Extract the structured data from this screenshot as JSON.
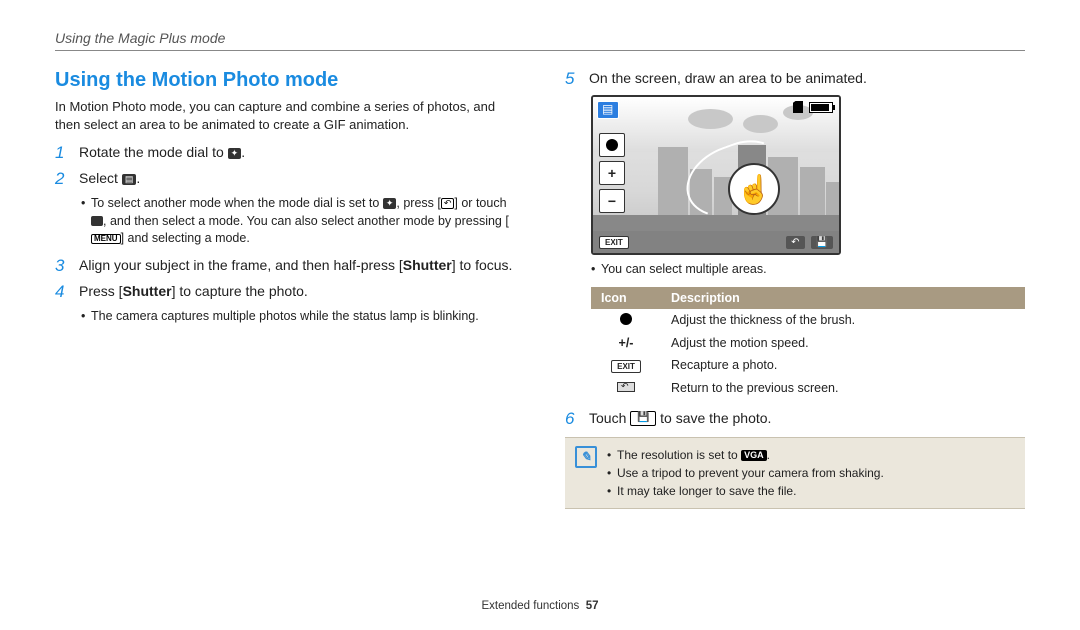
{
  "breadcrumb": "Using the Magic Plus mode",
  "heading": "Using the Motion Photo mode",
  "intro": "In Motion Photo mode, you can capture and combine a series of photos, and then select an area to be animated to create a GIF animation.",
  "steps": {
    "s1_pre": "Rotate the mode dial to ",
    "s1_post": ".",
    "s2_pre": "Select ",
    "s2_post": ".",
    "s2_sub_a_pre": "To select another mode when the mode dial is set to ",
    "s2_sub_a_mid1": ", press [",
    "s2_sub_a_mid2": "] or touch ",
    "s2_sub_a_mid3": ", and then select a mode. You can also select another mode by pressing [",
    "s2_sub_a_post": "] and selecting a mode.",
    "s3_pre": "Align your subject in the frame, and then half-press [",
    "s3_bold": "Shutter",
    "s3_post": "] to focus.",
    "s4_pre": "Press [",
    "s4_bold": "Shutter",
    "s4_post": "] to capture the photo.",
    "s4_sub": "The camera captures multiple photos while the status lamp is blinking.",
    "s5": "On the screen, draw an area to be animated.",
    "s5_sub": "You can select multiple areas.",
    "s6_pre": "Touch ",
    "s6_post": " to save the photo."
  },
  "table": {
    "h_icon": "Icon",
    "h_desc": "Description",
    "rows": [
      {
        "icon": "dot",
        "icon_text": "",
        "desc": "Adjust the thickness of the brush."
      },
      {
        "icon": "pm",
        "icon_text": "+/-",
        "desc": "Adjust the motion speed."
      },
      {
        "icon": "exit",
        "icon_text": "EXIT",
        "desc": "Recapture a photo."
      },
      {
        "icon": "return",
        "icon_text": "",
        "desc": "Return to the previous screen."
      }
    ]
  },
  "notes": {
    "n1_pre": "The resolution is set to ",
    "n1_vga": "VGA",
    "n1_post": ".",
    "n2": "Use a tripod to prevent your camera from shaking.",
    "n3": "It may take longer to save the file."
  },
  "screen": {
    "exit": "EXIT",
    "plus": "+",
    "minus": "−"
  },
  "icons": {
    "menu_label": "MENU"
  },
  "footer": {
    "section": "Extended functions",
    "page": "57"
  }
}
